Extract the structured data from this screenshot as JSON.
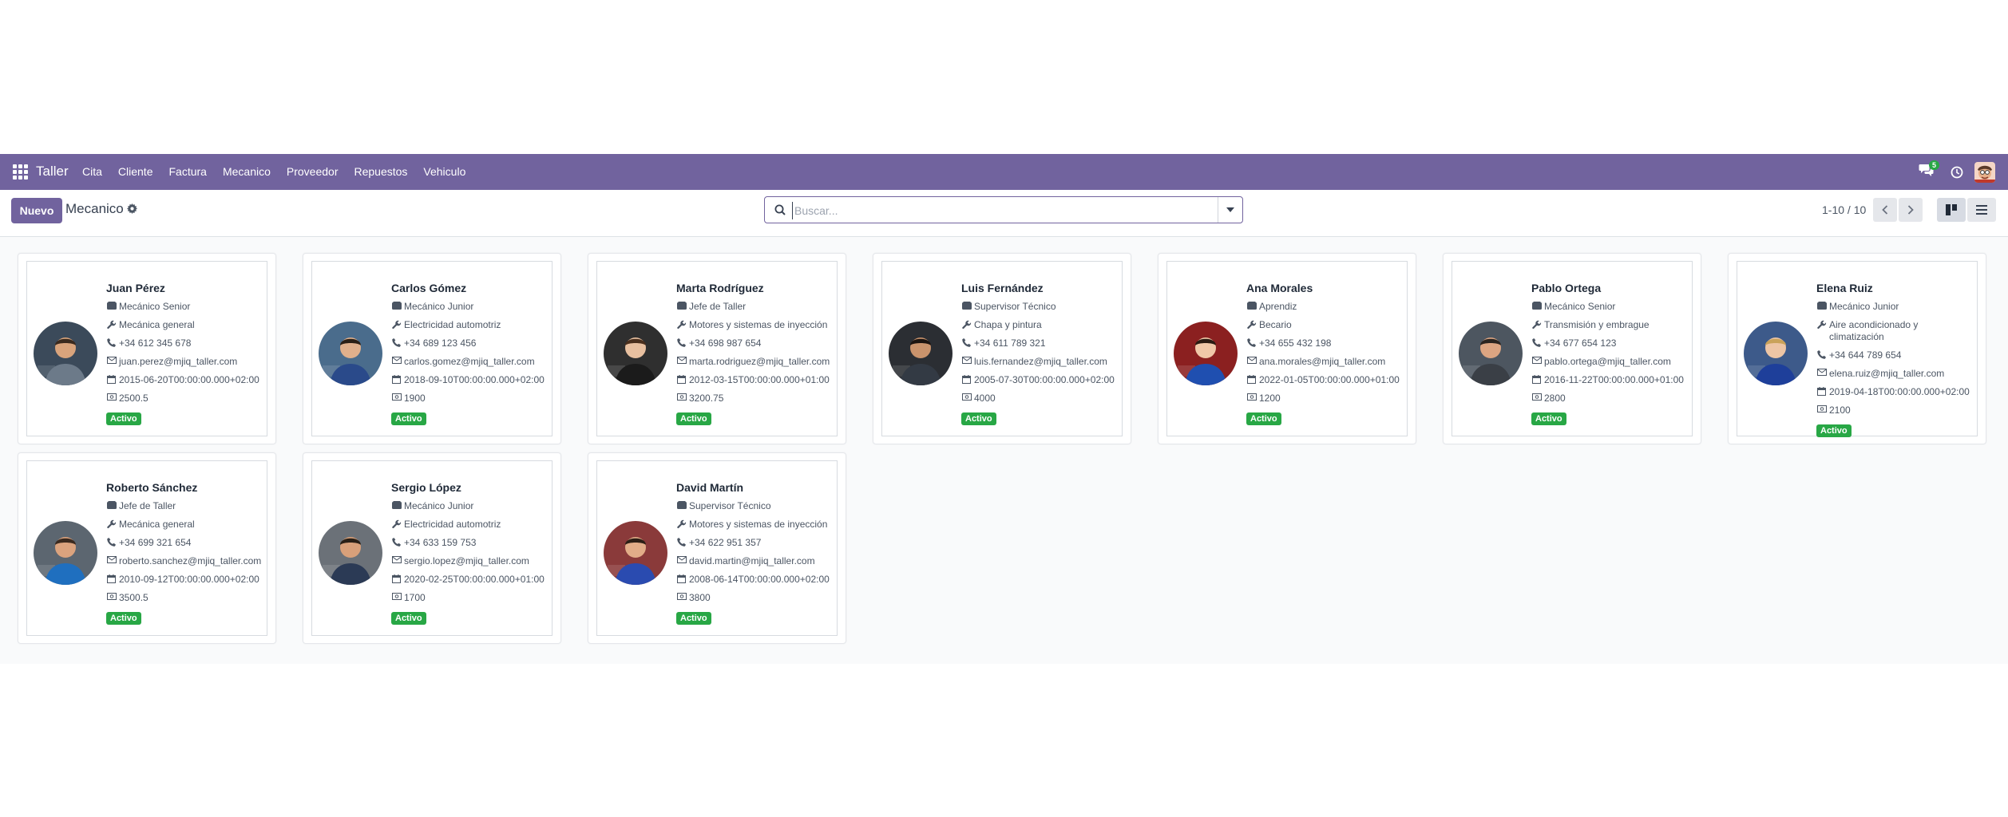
{
  "navbar": {
    "brand": "Taller",
    "menu": [
      "Cita",
      "Cliente",
      "Factura",
      "Mecanico",
      "Proveedor",
      "Repuestos",
      "Vehiculo"
    ],
    "messages_count": "5",
    "color": "#71639e"
  },
  "control_panel": {
    "new_button": "Nuevo",
    "title": "Mecanico",
    "search_placeholder": "Buscar...",
    "pager": "1-10 / 10",
    "active_view": "kanban"
  },
  "status_color": "#28a745",
  "mechanics": [
    {
      "name": "Juan Pérez",
      "role": "Mecánico Senior",
      "specialty": "Mecánica general",
      "phone": "+34 612 345 678",
      "email": "juan.perez@mjiq_taller.com",
      "date": "2015-06-20T00:00:00.000+02:00",
      "salary": "2500.5",
      "status": "Activo"
    },
    {
      "name": "Carlos Gómez",
      "role": "Mecánico Junior",
      "specialty": "Electricidad automotriz",
      "phone": "+34 689 123 456",
      "email": "carlos.gomez@mjiq_taller.com",
      "date": "2018-09-10T00:00:00.000+02:00",
      "salary": "1900",
      "status": "Activo"
    },
    {
      "name": "Marta Rodríguez",
      "role": "Jefe de Taller",
      "specialty": "Motores y sistemas de inyección",
      "phone": "+34 698 987 654",
      "email": "marta.rodriguez@mjiq_taller.com",
      "date": "2012-03-15T00:00:00.000+01:00",
      "salary": "3200.75",
      "status": "Activo"
    },
    {
      "name": "Luis Fernández",
      "role": "Supervisor Técnico",
      "specialty": "Chapa y pintura",
      "phone": "+34 611 789 321",
      "email": "luis.fernandez@mjiq_taller.com",
      "date": "2005-07-30T00:00:00.000+02:00",
      "salary": "4000",
      "status": "Activo"
    },
    {
      "name": "Ana Morales",
      "role": "Aprendiz",
      "specialty": "Becario",
      "phone": "+34 655 432 198",
      "email": "ana.morales@mjiq_taller.com",
      "date": "2022-01-05T00:00:00.000+01:00",
      "salary": "1200",
      "status": "Activo"
    },
    {
      "name": "Pablo Ortega",
      "role": "Mecánico Senior",
      "specialty": "Transmisión y embrague",
      "phone": "+34 677 654 123",
      "email": "pablo.ortega@mjiq_taller.com",
      "date": "2016-11-22T00:00:00.000+01:00",
      "salary": "2800",
      "status": "Activo"
    },
    {
      "name": "Elena Ruiz",
      "role": "Mecánico Junior",
      "specialty": "Aire acondicionado y climatización",
      "phone": "+34 644 789 654",
      "email": "elena.ruiz@mjiq_taller.com",
      "date": "2019-04-18T00:00:00.000+02:00",
      "salary": "2100",
      "status": "Activo"
    },
    {
      "name": "Roberto Sánchez",
      "role": "Jefe de Taller",
      "specialty": "Mecánica general",
      "phone": "+34 699 321 654",
      "email": "roberto.sanchez@mjiq_taller.com",
      "date": "2010-09-12T00:00:00.000+02:00",
      "salary": "3500.5",
      "status": "Activo"
    },
    {
      "name": "Sergio López",
      "role": "Mecánico Junior",
      "specialty": "Electricidad automotriz",
      "phone": "+34 633 159 753",
      "email": "sergio.lopez@mjiq_taller.com",
      "date": "2020-02-25T00:00:00.000+01:00",
      "salary": "1700",
      "status": "Activo"
    },
    {
      "name": "David Martín",
      "role": "Supervisor Técnico",
      "specialty": "Motores y sistemas de inyección",
      "phone": "+34 622 951 357",
      "email": "david.martin@mjiq_taller.com",
      "date": "2008-06-14T00:00:00.000+02:00",
      "salary": "3800",
      "status": "Activo"
    }
  ]
}
